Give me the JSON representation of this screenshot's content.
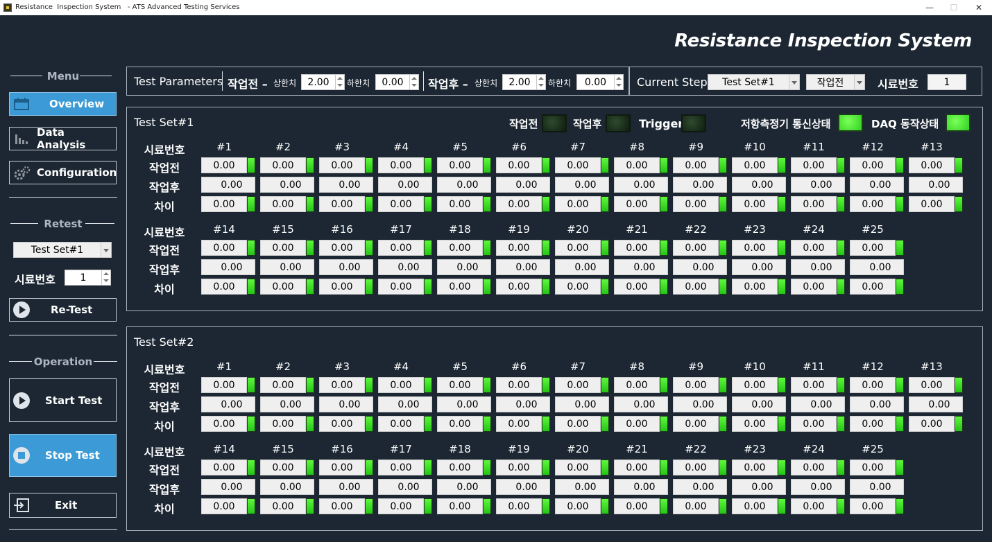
{
  "window": {
    "title": "Resistance  Inspection System   - ATS Advanced Testing Services",
    "minimize": "—",
    "maximize": "☐",
    "close": "✕"
  },
  "app_title": "Resistance Inspection System",
  "sidebar": {
    "menu_label": "Menu",
    "nav": [
      {
        "label": "Overview",
        "icon": "calendar-icon",
        "selected": true
      },
      {
        "label": "Data Analysis",
        "icon": "bar-chart-icon",
        "selected": false
      },
      {
        "label": "Configuration",
        "icon": "gears-icon",
        "selected": false
      }
    ],
    "retest_label": "Retest",
    "retest_set": "Test Set#1",
    "sample_label": "시료번호",
    "sample_value": "1",
    "retest_button": "Re-Test",
    "operation_label": "Operation",
    "start_button": "Start Test",
    "stop_button": "Stop Test",
    "exit_button": "Exit"
  },
  "params": {
    "title": "Test Parameters",
    "pre_label": "작업전 –",
    "upper_label": "상한치",
    "lower_label": "하한치",
    "pre_upper": "2.00",
    "pre_lower": "0.00",
    "post_label": "작업후 –",
    "post_upper": "2.00",
    "post_lower": "0.00"
  },
  "step": {
    "label": "Current Step",
    "set_value": "Test Set#1",
    "phase_value": "작업전",
    "sample_label": "시료번호",
    "sample_value": "1"
  },
  "status": {
    "pre": "작업전",
    "post": "작업후",
    "trigger": "Trigger",
    "meter": "저항측정기 통신상태",
    "daq": "DAQ 동작상태"
  },
  "row_labels": {
    "sample": "시료번호",
    "pre": "작업전",
    "post": "작업후",
    "diff": "차이"
  },
  "test_sets": [
    {
      "title": "Test Set#1",
      "samples": [
        "#1",
        "#2",
        "#3",
        "#4",
        "#5",
        "#6",
        "#7",
        "#8",
        "#9",
        "#10",
        "#11",
        "#12",
        "#13",
        "#14",
        "#15",
        "#16",
        "#17",
        "#18",
        "#19",
        "#20",
        "#21",
        "#22",
        "#23",
        "#24",
        "#25"
      ],
      "value": "0.00"
    },
    {
      "title": "Test Set#2",
      "samples": [
        "#1",
        "#2",
        "#3",
        "#4",
        "#5",
        "#6",
        "#7",
        "#8",
        "#9",
        "#10",
        "#11",
        "#12",
        "#13",
        "#14",
        "#15",
        "#16",
        "#17",
        "#18",
        "#19",
        "#20",
        "#21",
        "#22",
        "#23",
        "#24",
        "#25"
      ],
      "value": "0.00"
    }
  ],
  "colors": {
    "background": "#1c2733",
    "accent": "#3c9bd6",
    "led_on": "#4be82a",
    "led_off": "#1d301d"
  }
}
